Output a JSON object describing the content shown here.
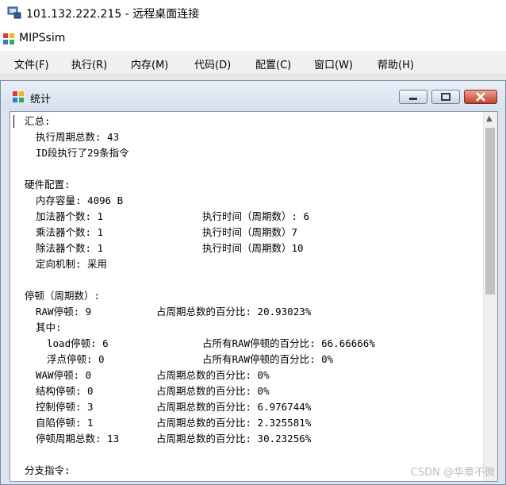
{
  "remote_desktop": {
    "title": "101.132.222.215 - 远程桌面连接",
    "icon": "monitor-network-icon"
  },
  "app": {
    "title": "MIPSsim",
    "icon": "app-logo-icon"
  },
  "menu": [
    "文件(F)",
    "执行(R)",
    "内存(M)",
    "代码(D)",
    "配置(C)",
    "窗口(W)",
    "帮助(H)"
  ],
  "child_window": {
    "title": "统计",
    "icon": "app-logo-icon",
    "buttons": [
      "minimize",
      "maximize",
      "close"
    ]
  },
  "stats": {
    "summary_header": "汇总:",
    "total_cycles": "执行周期总数: 43",
    "id_executed": "ID段执行了29条指令",
    "hw_header": "硬件配置:",
    "memory": "内存容量: 4096 B",
    "adder": "加法器个数: 1",
    "adder_time": "执行时间（周期数）: 6",
    "multiplier": "乘法器个数: 1",
    "multiplier_time": "执行时间（周期数）7",
    "divider": "除法器个数: 1",
    "divider_time": "执行时间（周期数）10",
    "forwarding": "定向机制: 采用",
    "stall_header": "停顿（周期数）:",
    "raw": "RAW停顿: 9",
    "raw_pct": "占周期总数的百分比: 20.93023%",
    "among": "其中:",
    "load_stall": "load停顿: 6",
    "load_pct": "占所有RAW停顿的百分比: 66.66666%",
    "fp_stall": "浮点停顿: 0",
    "fp_pct": "占所有RAW停顿的百分比: 0%",
    "waw": "WAW停顿: 0",
    "waw_pct": "占周期总数的百分比: 0%",
    "struct": "结构停顿: 0",
    "struct_pct": "占周期总数的百分比: 0%",
    "control": "控制停顿: 3",
    "control_pct": "占周期总数的百分比: 6.976744%",
    "trap": "自陷停顿: 1",
    "trap_pct": "占周期总数的百分比: 2.325581%",
    "total_stall": "停顿周期总数: 13",
    "total_stall_pct": "占周期总数的百分比: 30.23256%",
    "branch_header": "分支指令:"
  },
  "watermark": "CSDN @华章不微"
}
